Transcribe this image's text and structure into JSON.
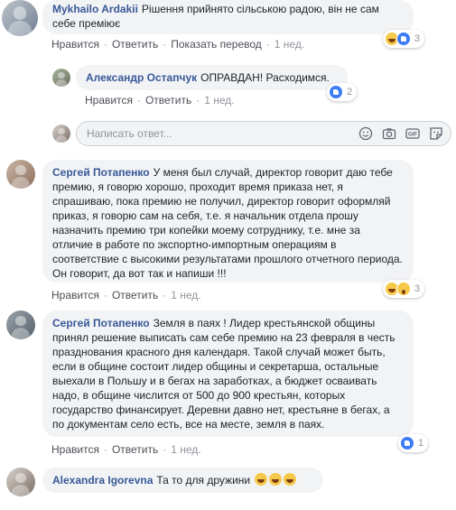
{
  "actions": {
    "like": "Нравится",
    "reply": "Ответить",
    "translate": "Показать перевод",
    "sep": "·"
  },
  "comments": [
    {
      "author": "Mykhailo Ardakii",
      "text": "Рішення прийнято сільською радою, він не сам себе преміює",
      "time": "1 нед.",
      "reactions": [
        "haha",
        "like"
      ],
      "reaction_count": "3"
    },
    {
      "author": "Александр Остапчук",
      "text": "ОПРАВДАН! Расходимся.",
      "time": "1 нед.",
      "reactions": [
        "like"
      ],
      "reaction_count": "2"
    },
    {
      "author": "Сергей Потапенко",
      "text": "У меня был случай, директор говорит даю тебе премию, я говорю хорошо, проходит время приказа нет, я спрашиваю, пока премию не получил, директор говорит оформляй приказ, я говорю сам на себя, т.е. я начальник отдела прошу назначить премию три копейки моему сотруднику, т.е. мне за отличие в работе по экспортно-импортным операциям в соответствие с высокими результатами прошлого отчетного периода. Он говорит, да вот так и напиши !!!",
      "time": "1 нед.",
      "reactions": [
        "haha",
        "wow"
      ],
      "reaction_count": "3"
    },
    {
      "author": "Сергей Потапенко",
      "text": "Земля в паях ! Лидер крестьянской общины принял решение выписать сам себе премию на 23 февраля в честь празднования красного дня календаря. Такой случай может быть, если в общине состоит лидер общины и секретарша, остальные выехали в Польшу и в бегах на заработках, а бюджет осваивать надо, в общине числится от 500 до 900 крестьян, которых государство финансирует. Деревни давно нет, крестьяне в бегах, а по документам село есть, все на месте, земля в паях.",
      "time": "1 нед.",
      "reactions": [
        "like"
      ],
      "reaction_count": "1"
    },
    {
      "author": "Alexandra Igorevna",
      "text": "Та то для дружини",
      "emoji": [
        "laughing-emoji",
        "laughing-emoji",
        "laughing-emoji"
      ]
    }
  ],
  "reply_box": {
    "placeholder": "Написать ответ...",
    "icons": [
      "smiley-icon",
      "camera-icon",
      "gif-icon",
      "sticker-icon"
    ]
  }
}
